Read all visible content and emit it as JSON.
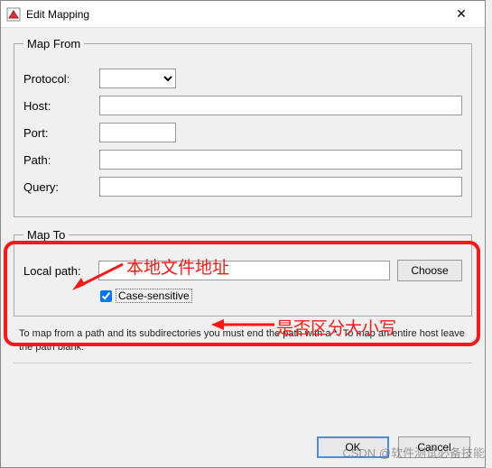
{
  "window": {
    "title": "Edit Mapping",
    "close_glyph": "✕"
  },
  "mapFrom": {
    "legend": "Map From",
    "protocol_label": "Protocol:",
    "protocol_value": "",
    "host_label": "Host:",
    "host_value": "",
    "port_label": "Port:",
    "port_value": "",
    "path_label": "Path:",
    "path_value": "",
    "query_label": "Query:",
    "query_value": ""
  },
  "mapTo": {
    "legend": "Map To",
    "local_label": "Local path:",
    "local_value": "",
    "choose_label": "Choose",
    "case_sensitive_label": "Case-sensitive",
    "case_sensitive_checked": true
  },
  "hint": "To map from a path and its subdirectories you must end the path with a *. To map an entire host leave the path blank.",
  "buttons": {
    "ok": "OK",
    "cancel": "Cancel"
  },
  "annotations": {
    "a1": "本地文件地址",
    "a2": "是否区分大小写"
  },
  "watermark": "CSDN @软件测试必备技能"
}
